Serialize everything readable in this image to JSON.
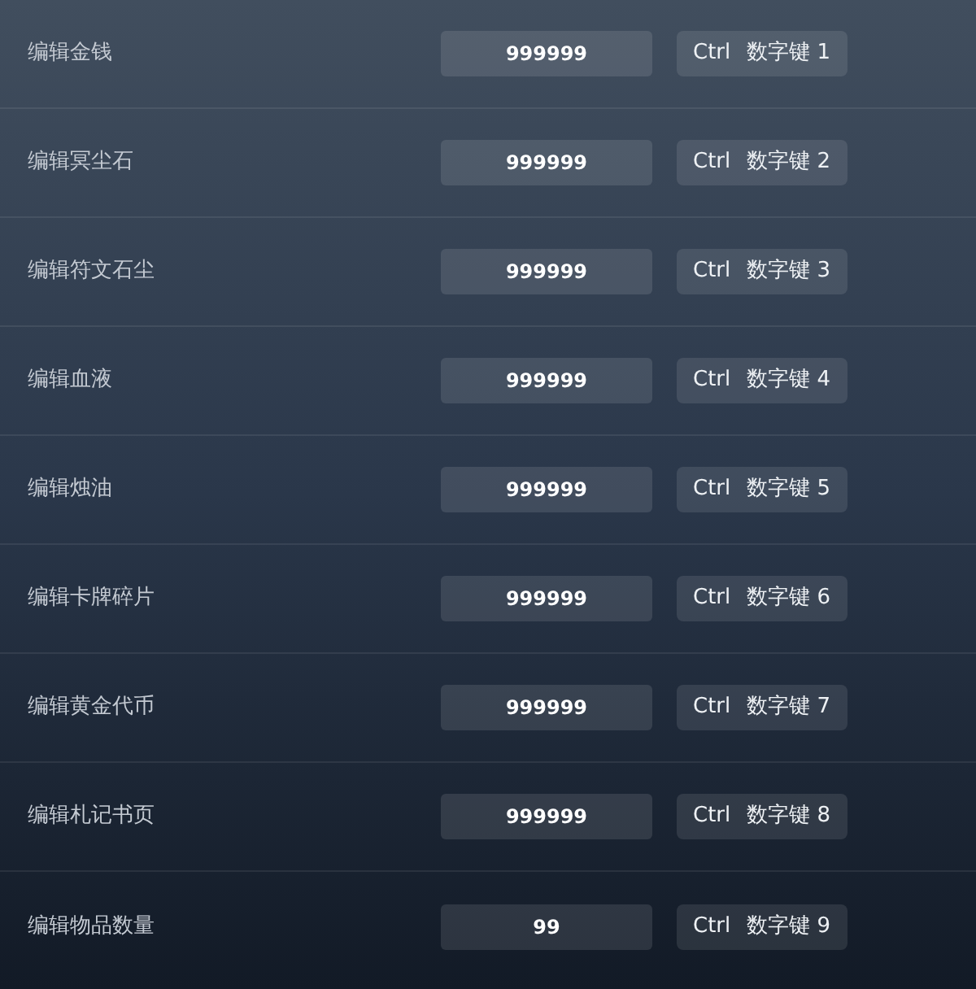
{
  "rows": [
    {
      "label": "编辑金钱",
      "value": "999999",
      "hotkey": [
        "Ctrl",
        "数字键 1"
      ]
    },
    {
      "label": "编辑冥尘石",
      "value": "999999",
      "hotkey": [
        "Ctrl",
        "数字键 2"
      ]
    },
    {
      "label": "编辑符文石尘",
      "value": "999999",
      "hotkey": [
        "Ctrl",
        "数字键 3"
      ]
    },
    {
      "label": "编辑血液",
      "value": "999999",
      "hotkey": [
        "Ctrl",
        "数字键 4"
      ]
    },
    {
      "label": "编辑烛油",
      "value": "999999",
      "hotkey": [
        "Ctrl",
        "数字键 5"
      ]
    },
    {
      "label": "编辑卡牌碎片",
      "value": "999999",
      "hotkey": [
        "Ctrl",
        "数字键 6"
      ]
    },
    {
      "label": "编辑黄金代币",
      "value": "999999",
      "hotkey": [
        "Ctrl",
        "数字键 7"
      ]
    },
    {
      "label": "编辑札记书页",
      "value": "999999",
      "hotkey": [
        "Ctrl",
        "数字键 8"
      ]
    },
    {
      "label": "编辑物品数量",
      "value": "99",
      "hotkey": [
        "Ctrl",
        "数字键 9"
      ]
    }
  ]
}
